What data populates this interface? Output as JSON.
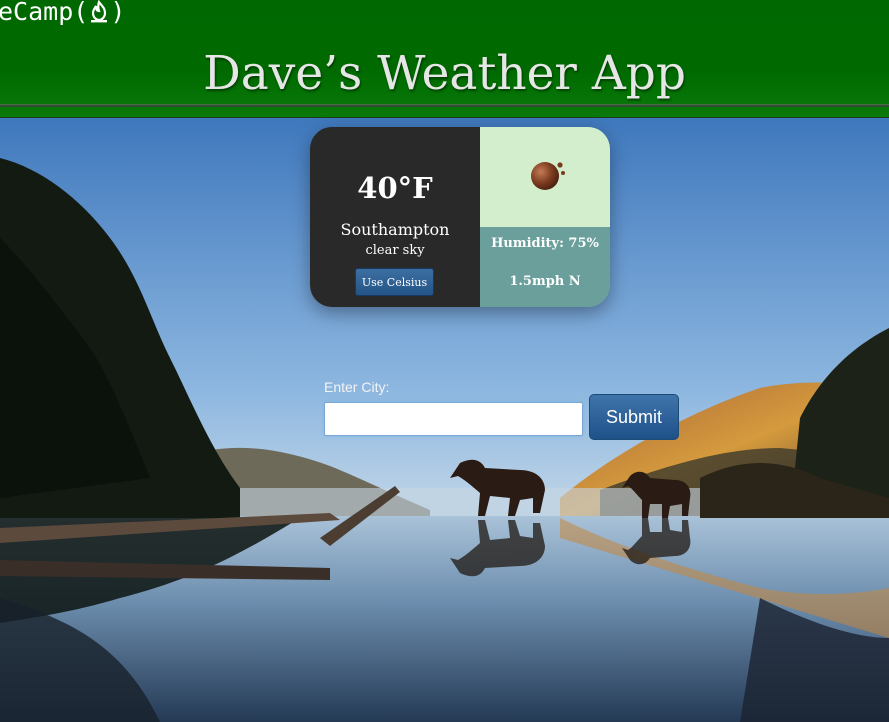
{
  "header": {
    "brand_text": "eCamp(",
    "brand_close": ")",
    "title": "Dave’s Weather App"
  },
  "weather": {
    "temperature": "40°F",
    "city": "Southampton",
    "description": "clear sky",
    "unit_toggle_label": "Use Celsius",
    "humidity": "Humidity: 75%",
    "wind": "1.5mph N",
    "icon": "sun-icon"
  },
  "form": {
    "label": "Enter City:",
    "input_value": "",
    "submit_label": "Submit"
  },
  "colors": {
    "header_green": "#006800",
    "card_dark": "#292929",
    "icon_bg": "#d3eecd",
    "stats_bg": "#6a9f9c",
    "button_blue": "#2a5f96"
  }
}
